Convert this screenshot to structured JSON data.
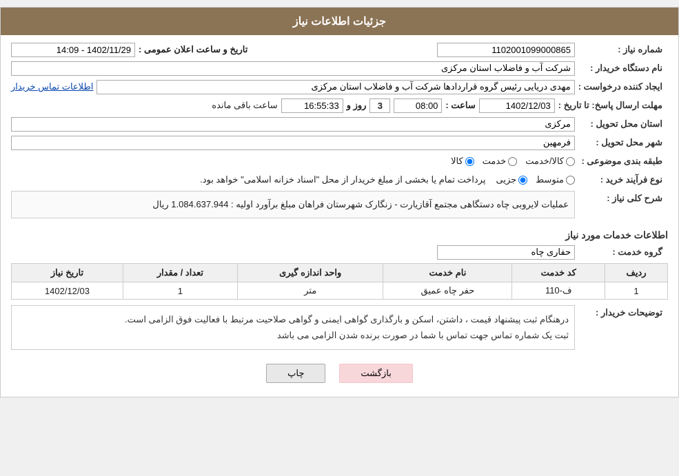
{
  "header": {
    "title": "جزئیات اطلاعات نیاز"
  },
  "fields": {
    "need_number_label": "شماره نیاز :",
    "need_number_value": "1102001099000865",
    "buyer_org_label": "نام دستگاه خریدار :",
    "buyer_org_value": "شرکت آب و فاضلاب استان مرکزی",
    "requester_label": "ایجاد کننده درخواست :",
    "requester_value": "مهدی دریایی رئیس گروه قراردادها شرکت آب و فاضلاب استان مرکزی",
    "contact_link": "اطلاعات تماس خریدار",
    "announcement_datetime_label": "تاریخ و ساعت اعلان عمومی :",
    "announcement_datetime_value": "1402/11/29 - 14:09",
    "deadline_label": "مهلت ارسال پاسخ: تا تاریخ :",
    "deadline_date": "1402/12/03",
    "deadline_time_label": "ساعت :",
    "deadline_time": "08:00",
    "deadline_days_label": "روز و",
    "deadline_days": "3",
    "deadline_remaining_label": "ساعت باقی مانده",
    "deadline_remaining": "16:55:33",
    "province_label": "استان محل تحویل :",
    "province_value": "مرکزی",
    "city_label": "شهر محل تحویل :",
    "city_value": "فرمهین",
    "category_label": "طبقه بندی موضوعی :",
    "category_kala": "کالا",
    "category_khadamat": "خدمت",
    "category_kala_khadamat": "کالا/خدمت",
    "process_label": "نوع فرآیند خرید :",
    "process_jozi": "جزیی",
    "process_motawaset": "متوسط",
    "process_note": "پرداخت تمام یا بخشی از مبلغ خریدار از محل \"اسناد خزانه اسلامی\" خواهد بود.",
    "needs_desc_label": "شرح کلی نیاز :",
    "needs_desc_value": "عملیات لایروبی چاه دستگاهی مجتمع آقازیارت - زنگارک شهرستان فراهان  مبلغ برآورد اولیه : 1.084.637.944 ریال",
    "service_info_title": "اطلاعات خدمات مورد نیاز",
    "service_group_label": "گروه خدمت :",
    "service_group_value": "حفاری چاه",
    "table": {
      "headers": [
        "ردیف",
        "کد خدمت",
        "نام خدمت",
        "واحد اندازه گیری",
        "تعداد / مقدار",
        "تاریخ نیاز"
      ],
      "rows": [
        {
          "row": "1",
          "code": "ف-110",
          "name": "حفر چاه عمیق",
          "unit": "متر",
          "quantity": "1",
          "date": "1402/12/03"
        }
      ]
    },
    "buyer_notes_label": "توضیحات خریدار :",
    "buyer_notes_value": "درهنگام ثبت پیشنهاد قیمت ، داشتن، اسکن و بارگذاری گواهی ایمنی و گواهی صلاحیت مرتبط با فعالیت فوق الزامی است.\nثبت یک شماره تماس جهت تماس با شما در صورت برنده شدن الزامی می باشد",
    "btn_print": "چاپ",
    "btn_back": "بازگشت"
  }
}
